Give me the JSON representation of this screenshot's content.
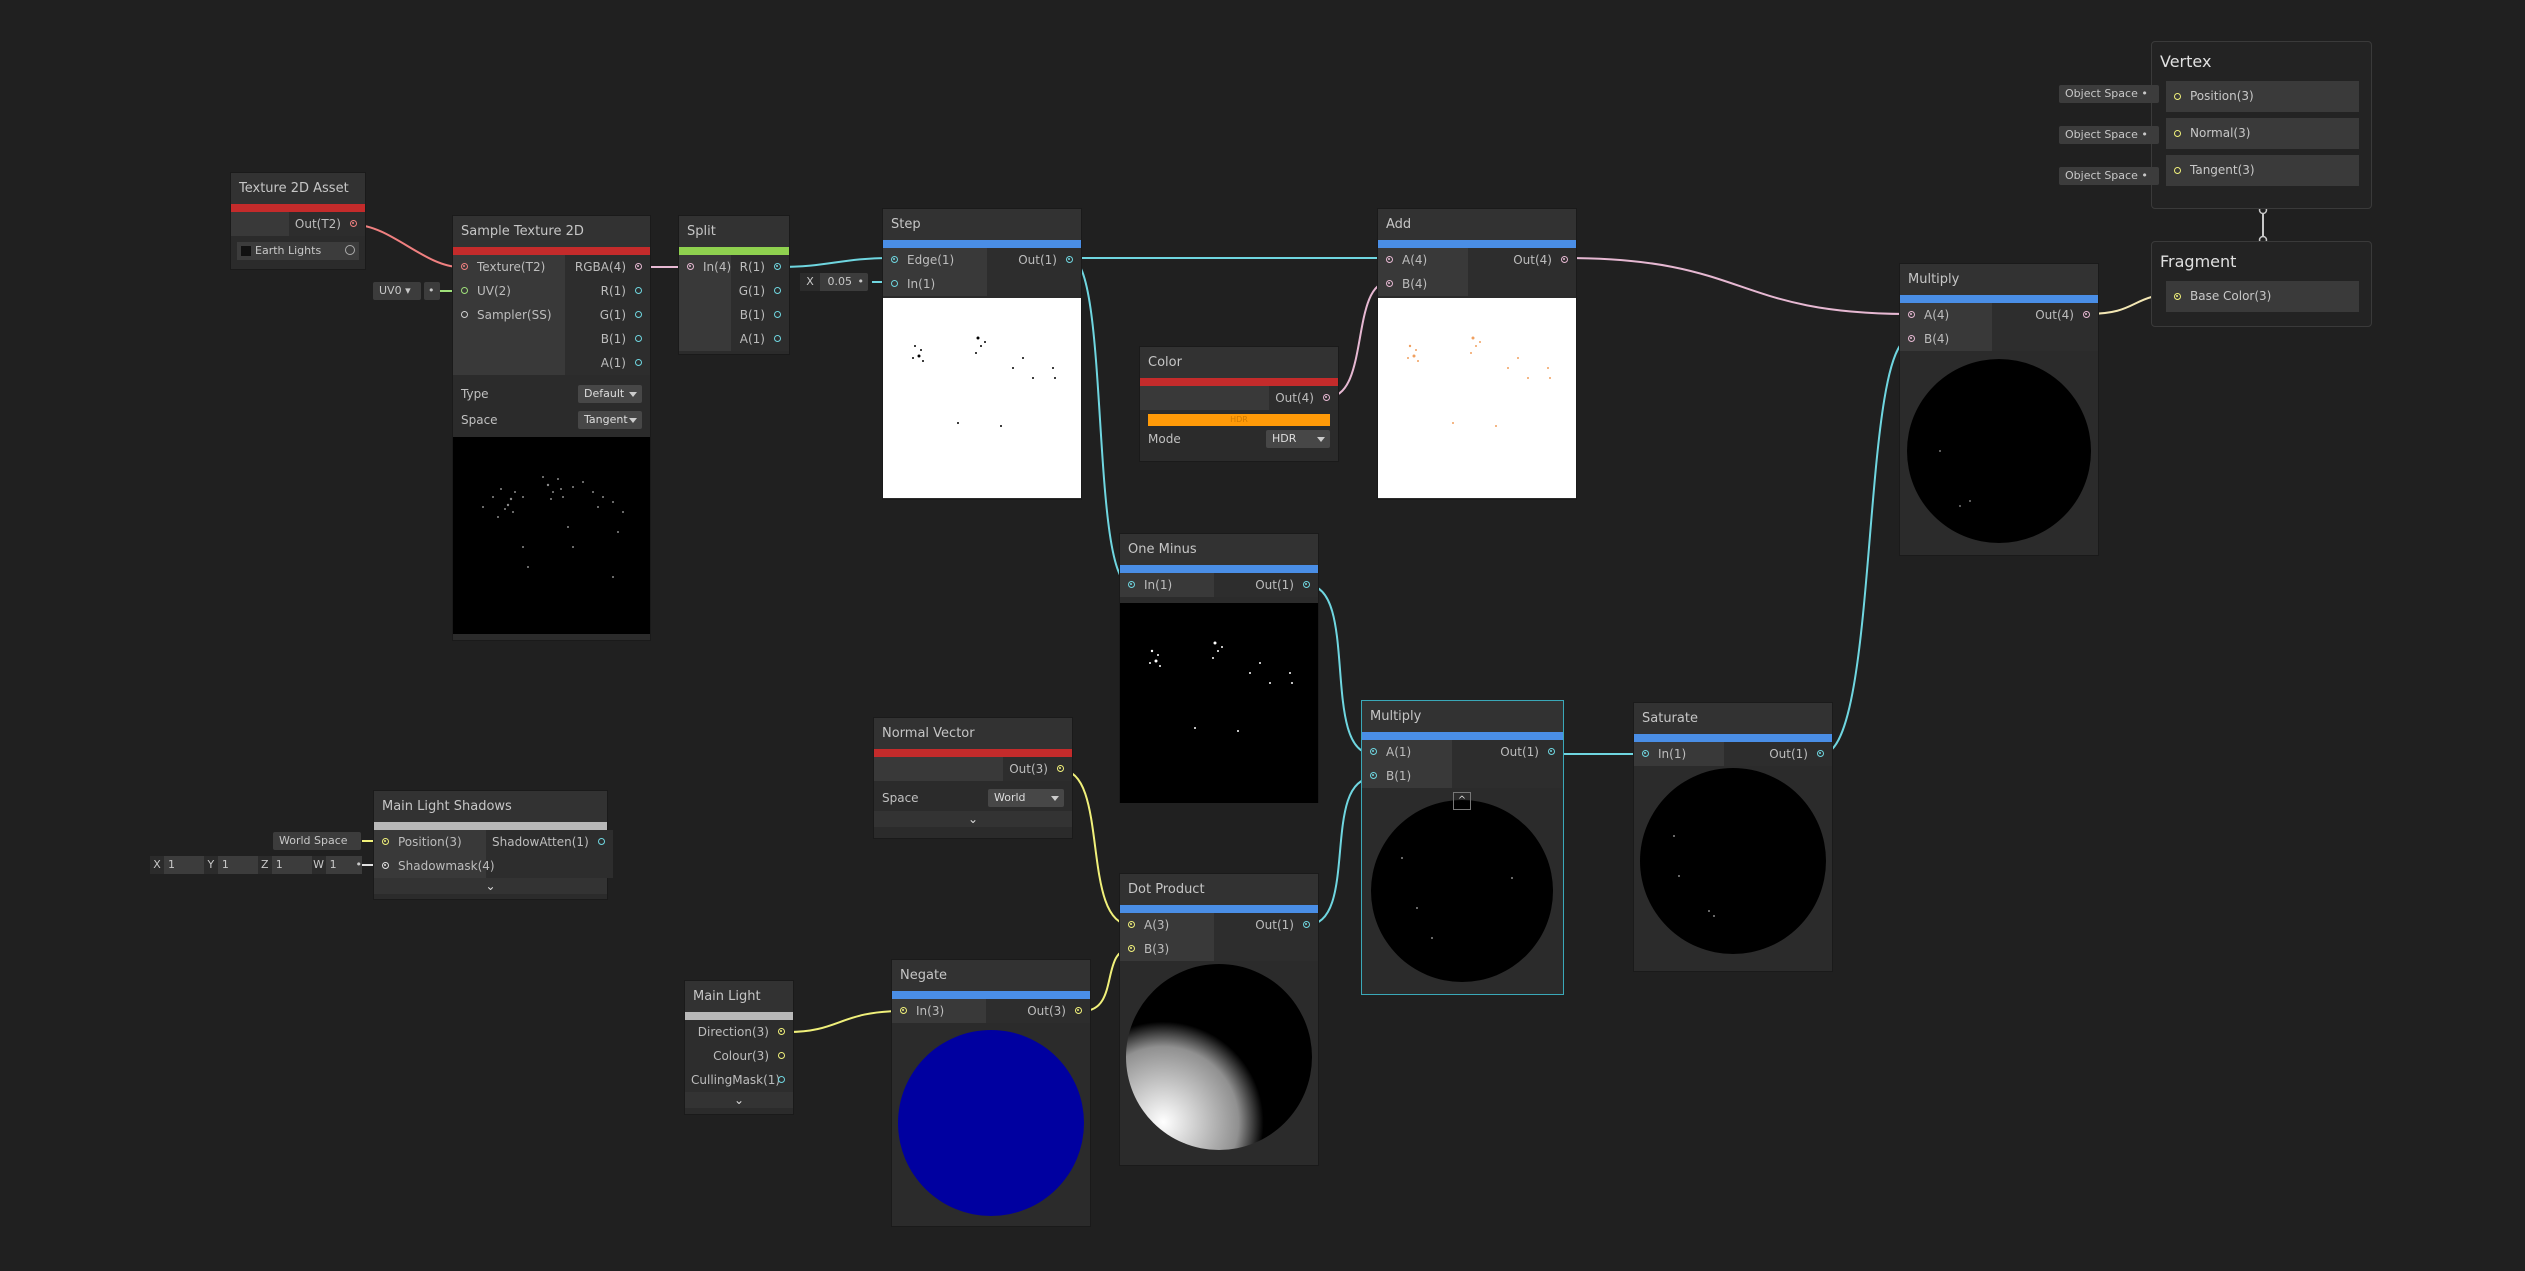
{
  "colors": {
    "background": "#202020",
    "texture_accent": "#c42b2b",
    "vector_accent": "#4a8ee6",
    "green_accent": "#8fd14f",
    "gray_accent": "#b8b8b8",
    "wire_texture": "#f08080",
    "wire_float": "#6fd6e0",
    "wire_vec4": "#e6b8d2",
    "wire_vec3": "#f0f07a",
    "color_swatch": "#ff9a08"
  },
  "texture_asset": {
    "title": "Texture 2D Asset",
    "out": "Out(T2)",
    "texture_value": "Earth Lights"
  },
  "sample_texture": {
    "title": "Sample Texture 2D",
    "inputs": [
      "Texture(T2)",
      "UV(2)",
      "Sampler(SS)"
    ],
    "outputs": [
      "RGBA(4)",
      "R(1)",
      "G(1)",
      "B(1)",
      "A(1)"
    ],
    "uv_value": "UV0",
    "type_label": "Type",
    "type_value": "Default",
    "space_label": "Space",
    "space_value": "Tangent"
  },
  "split": {
    "title": "Split",
    "inputs": [
      "In(4)"
    ],
    "outputs": [
      "R(1)",
      "G(1)",
      "B(1)",
      "A(1)"
    ]
  },
  "step": {
    "title": "Step",
    "inputs": [
      "Edge(1)",
      "In(1)"
    ],
    "outputs": [
      "Out(1)"
    ],
    "in_axis": "X",
    "in_value": "0.05"
  },
  "add": {
    "title": "Add",
    "inputs": [
      "A(4)",
      "B(4)"
    ],
    "outputs": [
      "Out(4)"
    ]
  },
  "color": {
    "title": "Color",
    "outputs": [
      "Out(4)"
    ],
    "mode_label": "Mode",
    "mode_value": "HDR",
    "swatch_text": "HDR"
  },
  "one_minus": {
    "title": "One Minus",
    "inputs": [
      "In(1)"
    ],
    "outputs": [
      "Out(1)"
    ]
  },
  "multiply_mid": {
    "title": "Multiply",
    "inputs": [
      "A(1)",
      "B(1)"
    ],
    "outputs": [
      "Out(1)"
    ]
  },
  "saturate": {
    "title": "Saturate",
    "inputs": [
      "In(1)"
    ],
    "outputs": [
      "Out(1)"
    ]
  },
  "multiply_right": {
    "title": "Multiply",
    "inputs": [
      "A(4)",
      "B(4)"
    ],
    "outputs": [
      "Out(4)"
    ]
  },
  "normal_vector": {
    "title": "Normal Vector",
    "outputs": [
      "Out(3)"
    ],
    "space_label": "Space",
    "space_value": "World"
  },
  "main_light_shadows": {
    "title": "Main Light Shadows",
    "inputs": [
      "Position(3)",
      "Shadowmask(4)"
    ],
    "outputs": [
      "ShadowAtten(1)"
    ],
    "position_value": "World Space",
    "shadowmask": [
      {
        "axis": "X",
        "value": "1"
      },
      {
        "axis": "Y",
        "value": "1"
      },
      {
        "axis": "Z",
        "value": "1"
      },
      {
        "axis": "W",
        "value": "1"
      }
    ]
  },
  "dot_product": {
    "title": "Dot Product",
    "inputs": [
      "A(3)",
      "B(3)"
    ],
    "outputs": [
      "Out(1)"
    ]
  },
  "negate": {
    "title": "Negate",
    "inputs": [
      "In(3)"
    ],
    "outputs": [
      "Out(3)"
    ]
  },
  "main_light": {
    "title": "Main Light",
    "outputs": [
      "Direction(3)",
      "Colour(3)",
      "CullingMask(1)"
    ]
  },
  "vertex": {
    "title": "Vertex",
    "blocks": [
      "Position(3)",
      "Normal(3)",
      "Tangent(3)"
    ],
    "space_value": "Object Space"
  },
  "fragment": {
    "title": "Fragment",
    "blocks": [
      "Base Color(3)"
    ]
  }
}
